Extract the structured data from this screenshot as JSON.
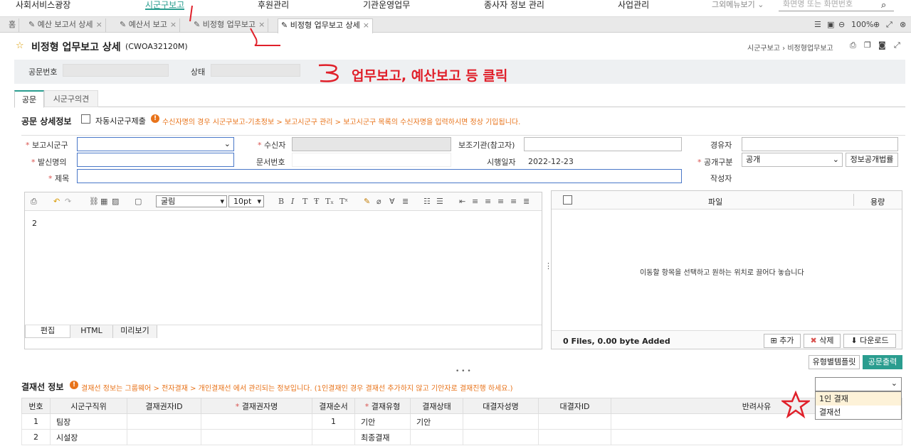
{
  "top_nav": {
    "items": [
      "사회서비스광장",
      "시군구보고",
      "후원관리",
      "기관운영업무",
      "종사자 정보 관리",
      "사업관리"
    ],
    "active": "시군구보고",
    "other_menu": "그외메뉴보기",
    "search_placeholder": "화면명 또는 화면번호"
  },
  "tabs": {
    "home": "홈",
    "items": [
      "예산 보고서 상세",
      "예산서 보고",
      "비정형 업무보고",
      "비정형 업무보고 상세"
    ]
  },
  "zoom": "100%",
  "page": {
    "title": "비정형 업무보고 상세",
    "code": "(CWOA32120M)",
    "breadcrumb": [
      "시군구보고",
      "비정형업무보고"
    ]
  },
  "info": {
    "doc_no_label": "공문번호",
    "status_label": "상태"
  },
  "annotation": {
    "text": "업무보고, 예산보고 등 클릭",
    "marks": [
      "1",
      "2",
      "3"
    ]
  },
  "subtabs": [
    "공문",
    "시군구의견"
  ],
  "detail": {
    "title": "공문 상세정보",
    "auto_submit": "자동시군구제출",
    "notice": "수신자명의 경우 시군구보고-기초정보 > 보고시군구 관리 > 보고시군구 목록의 수신자명을 입력하시면 정상 기입됩니다."
  },
  "form": {
    "report_city": "보고시군구",
    "receiver": "수신자",
    "aux_org": "보조기관(참고자)",
    "via": "경유자",
    "sender": "발신명의",
    "doc_num": "문서번호",
    "exec_date_label": "시행일자",
    "exec_date": "2022-12-23",
    "public_label": "공개구분",
    "public_value": "공개",
    "public_law_btn": "정보공개법률",
    "subject": "제목",
    "author": "작성자"
  },
  "editor": {
    "font": "굴림",
    "size": "10pt",
    "content": "2",
    "tabs": [
      "편집",
      "HTML",
      "미리보기"
    ]
  },
  "files": {
    "col_file": "파일",
    "col_size": "용량",
    "drop_hint": "이동할 항목을 선택하고 원하는 위치로 끌어다 놓습니다",
    "summary": "0 Files, 0.00 byte Added",
    "add": "추가",
    "delete": "삭제",
    "download": "다운로드"
  },
  "buttons": {
    "template": "유형별템플릿",
    "print": "공문출력"
  },
  "approval": {
    "title": "결재선 정보",
    "notice": "결재선 정보는 그룹웨어 > 전자결재 > 개인결재선 에서 관리되는 정보입니다. (1인결재인 경우 결재선 추가하지 않고 기안자로 결재진행 하세요.)",
    "columns": [
      "번호",
      "시군구직위",
      "결재권자ID",
      "결재권자명",
      "결재순서",
      "결재유형",
      "결재상태",
      "대결자성명",
      "대결자ID",
      "반려사유"
    ],
    "rows": [
      [
        "1",
        "팀장",
        "",
        "",
        "1",
        "기안",
        "기안",
        "",
        "",
        ""
      ],
      [
        "2",
        "시설장",
        "",
        "",
        "",
        "최종결재",
        "",
        "",
        "",
        ""
      ]
    ],
    "dropdown_options": [
      "1인 결재",
      "결재선"
    ]
  },
  "colors": {
    "accent": "#2a9d8f",
    "warning": "#e8731a",
    "annotation_red": "#e0202a"
  }
}
